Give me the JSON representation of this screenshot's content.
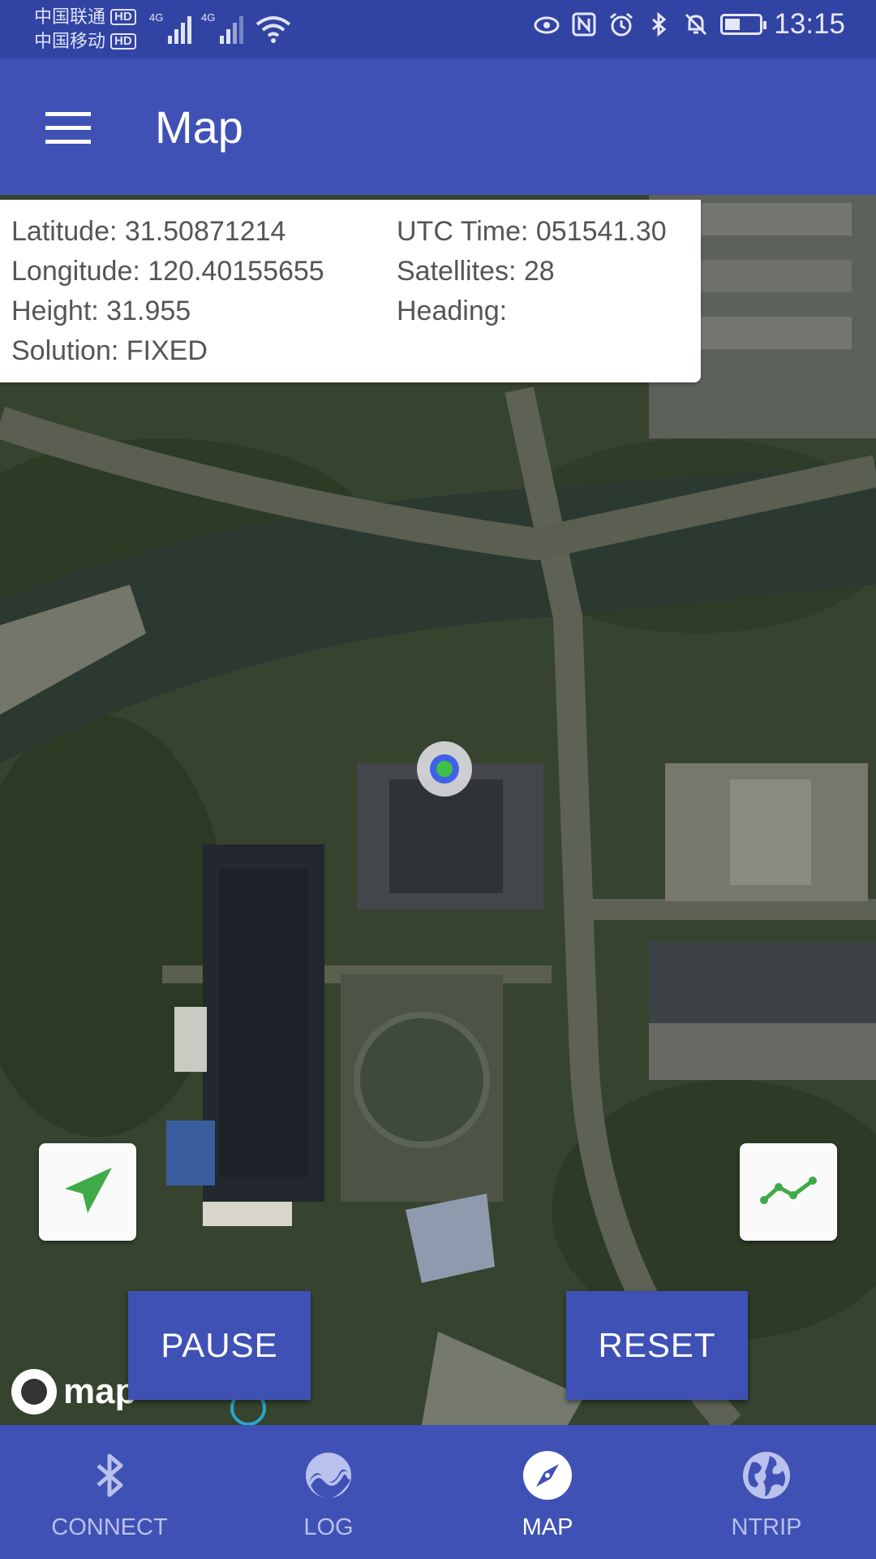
{
  "status_bar": {
    "carrier1": "中国联通",
    "carrier2": "中国移动",
    "hd": "HD",
    "net": "4G",
    "time": "13:15"
  },
  "app_bar": {
    "title": "Map"
  },
  "info": {
    "latitude": "Latitude: 31.50871214",
    "longitude": "Longitude: 120.40155655",
    "height": "Height: 31.955",
    "solution": "Solution: FIXED",
    "utc_time": "UTC Time: 051541.30",
    "satellites": "Satellites: 28",
    "heading": "Heading:"
  },
  "map": {
    "attribution": "map",
    "icons": {
      "locate": "navigation-arrow-icon",
      "track": "chart-line-icon"
    }
  },
  "actions": {
    "pause": "PAUSE",
    "reset": "RESET"
  },
  "nav": {
    "items": [
      {
        "label": "CONNECT",
        "icon": "bluetooth-icon"
      },
      {
        "label": "LOG",
        "icon": "log-icon"
      },
      {
        "label": "MAP",
        "icon": "compass-icon"
      },
      {
        "label": "NTRIP",
        "icon": "globe-icon"
      }
    ],
    "active": "MAP"
  },
  "colors": {
    "primary": "#3f51b5",
    "status_bar": "#3143a3",
    "accent_green": "#3fab48"
  }
}
